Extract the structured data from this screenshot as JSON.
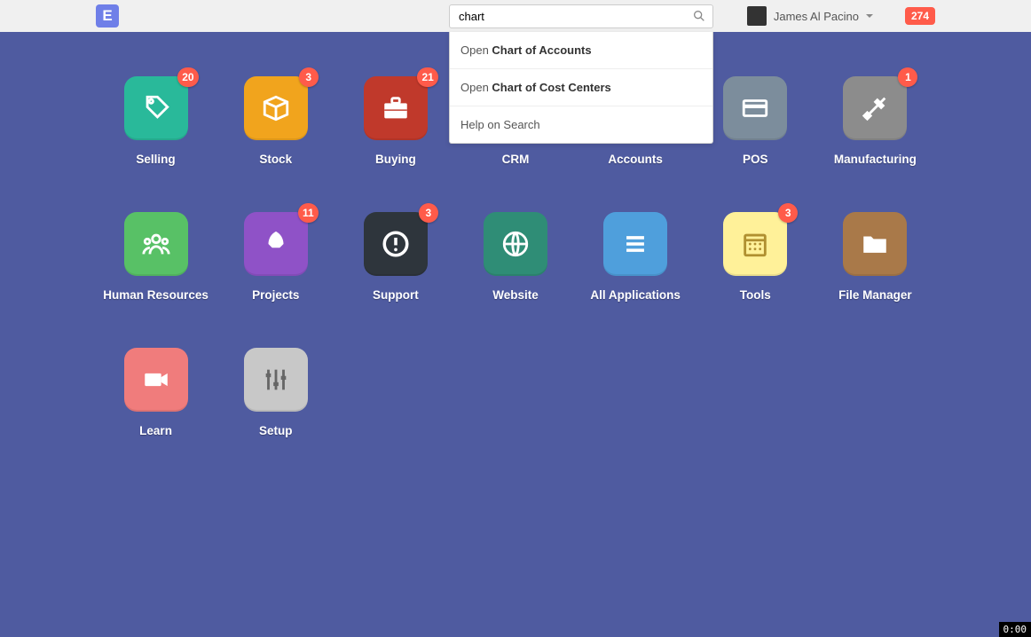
{
  "header": {
    "logo_letter": "E",
    "search_value": "chart",
    "user_name": "James Al Pacino",
    "notification_count": "274"
  },
  "dropdown": {
    "items": [
      {
        "prefix": "Open ",
        "bold": "Chart of Accounts"
      },
      {
        "prefix": "Open ",
        "bold": "Chart of Cost Centers"
      },
      {
        "prefix": "Help on Search",
        "bold": ""
      }
    ]
  },
  "modules": [
    {
      "label": "Selling",
      "color": "#29b99a",
      "icon": "tag",
      "badge": "20"
    },
    {
      "label": "Stock",
      "color": "#f1a41d",
      "icon": "box",
      "badge": "3"
    },
    {
      "label": "Buying",
      "color": "#c0392b",
      "icon": "briefcase",
      "badge": "21"
    },
    {
      "label": "CRM",
      "color": "#ec8b74",
      "icon": "heart",
      "badge": ""
    },
    {
      "label": "Accounts",
      "color": "#42a5b3",
      "icon": "money",
      "badge": ""
    },
    {
      "label": "POS",
      "color": "#7c8d9c",
      "icon": "card",
      "badge": ""
    },
    {
      "label": "Manufacturing",
      "color": "#8c8c8c",
      "icon": "tools",
      "badge": "1"
    },
    {
      "label": "Human Resources",
      "color": "#58c166",
      "icon": "people",
      "badge": ""
    },
    {
      "label": "Projects",
      "color": "#8f52c7",
      "icon": "rocket",
      "badge": "11"
    },
    {
      "label": "Support",
      "color": "#2e353c",
      "icon": "alert",
      "badge": "3"
    },
    {
      "label": "Website",
      "color": "#2f8d76",
      "icon": "globe",
      "badge": ""
    },
    {
      "label": "All Applications",
      "color": "#4f9fdc",
      "icon": "menu",
      "badge": ""
    },
    {
      "label": "Tools",
      "color": "#fff199",
      "icon": "calendar",
      "badge": "3"
    },
    {
      "label": "File Manager",
      "color": "#a97949",
      "icon": "folder",
      "badge": ""
    },
    {
      "label": "Learn",
      "color": "#f07c7c",
      "icon": "video",
      "badge": ""
    },
    {
      "label": "Setup",
      "color": "#c8c8c8",
      "icon": "sliders",
      "badge": ""
    }
  ],
  "timer": "0:00"
}
